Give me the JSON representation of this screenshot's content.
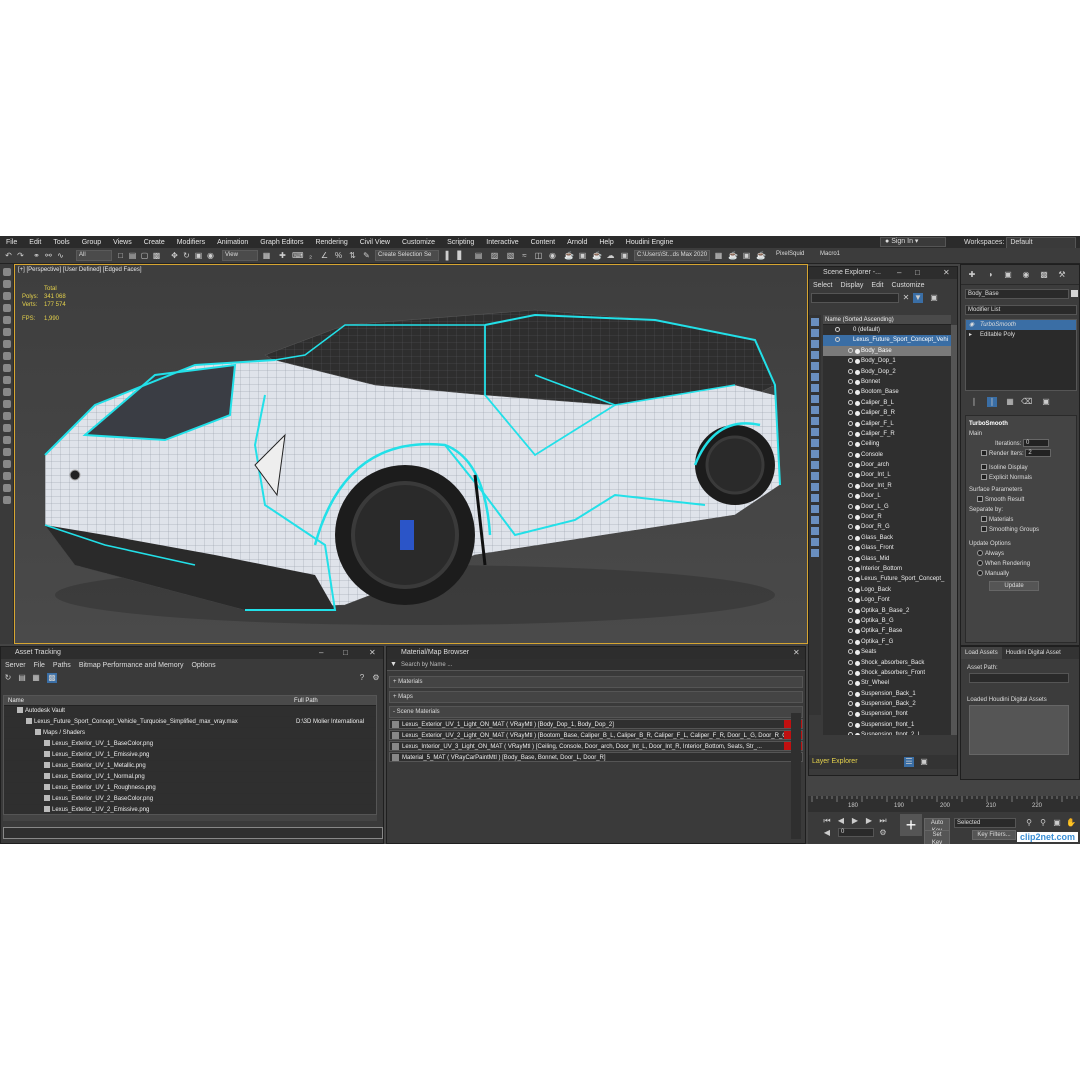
{
  "menu": [
    "File",
    "Edit",
    "Tools",
    "Group",
    "Views",
    "Create",
    "Modifiers",
    "Animation",
    "Graph Editors",
    "Rendering",
    "Civil View",
    "Customize",
    "Scripting",
    "Interactive",
    "Content",
    "Arnold",
    "Help",
    "Houdini Engine"
  ],
  "signin": "Sign In",
  "workspaces": {
    "label": "Workspaces:",
    "value": "Default"
  },
  "toolbar": {
    "filter": "All",
    "view": "View",
    "selection_set": "Create Selection Se",
    "path": "C:\\Users\\St...ds Max 2020",
    "pixelsquid": "PixelSquid",
    "macro": "Macro1"
  },
  "viewport": {
    "label": "[+] [Perspective] [User Defined] [Edged Faces]",
    "stats": {
      "total": "Total",
      "polys_label": "Polys:",
      "polys": "341 068",
      "verts_label": "Verts:",
      "verts": "177 574",
      "fps_label": "FPS:",
      "fps": "1,990"
    }
  },
  "scene_explorer": {
    "title": "Scene Explorer -...",
    "menu": [
      "Select",
      "Display",
      "Edit",
      "Customize"
    ],
    "column": "Name (Sorted Ascending)",
    "layer": "0 (default)",
    "root": "Lexus_Future_Sport_Concept_Vehi",
    "items": [
      "Body_Base",
      "Body_Dop_1",
      "Body_Dop_2",
      "Bonnet",
      "Bootom_Base",
      "Caliper_B_L",
      "Caliper_B_R",
      "Caliper_F_L",
      "Caliper_F_R",
      "Ceiling",
      "Console",
      "Door_arch",
      "Door_Int_L",
      "Door_Int_R",
      "Door_L",
      "Door_L_G",
      "Door_R",
      "Door_R_G",
      "Glass_Back",
      "Glass_Front",
      "Glass_Mid",
      "Interior_Bottom",
      "Lexus_Future_Sport_Concept_",
      "Logo_Back",
      "Logo_Font",
      "Optika_B_Base_2",
      "Optika_B_G",
      "Optika_F_Base",
      "Optika_F_G",
      "Seats",
      "Shock_absorbers_Back",
      "Shock_absorbers_Front",
      "Str_Wheel",
      "Suspension_Back_1",
      "Suspension_Back_2",
      "Suspension_front",
      "Suspension_front_1",
      "Suspension_front_2_L"
    ],
    "footer": "Layer Explorer"
  },
  "modifier_panel": {
    "object_name": "Body_Base",
    "modifier_list": "Modifier List",
    "stack": [
      "TurboSmooth",
      "Editable Poly"
    ],
    "rollout": "TurboSmooth",
    "main": "Main",
    "iterations_label": "Iterations:",
    "iterations": "0",
    "render_iters_label": "Render Iters:",
    "render_iters": "2",
    "isoline": "Isoline Display",
    "explicit": "Explicit Normals",
    "surface_params": "Surface Parameters",
    "smooth_result": "Smooth Result",
    "separate_by": "Separate by:",
    "materials": "Materials",
    "smoothing_groups": "Smoothing Groups",
    "update_options": "Update Options",
    "always": "Always",
    "when_rendering": "When Rendering",
    "manually": "Manually",
    "update_btn": "Update"
  },
  "assets_panel": {
    "tabs": [
      "Load Assets",
      "Houdini Digital Asset"
    ],
    "asset_path": "Asset Path:",
    "loaded": "Loaded Houdini Digital Assets"
  },
  "asset_tracking": {
    "title": "Asset Tracking",
    "menu": [
      "Server",
      "File",
      "Paths",
      "Bitmap Performance and Memory",
      "Options"
    ],
    "columns": [
      "Name",
      "Full Path"
    ],
    "rows": [
      {
        "name": "Autodesk Vault",
        "path": "",
        "indent": 1
      },
      {
        "name": "Lexus_Future_Sport_Concept_Vehicle_Turquoise_Simplified_max_vray.max",
        "path": "D:\\3D Molier International",
        "indent": 2
      },
      {
        "name": "Maps / Shaders",
        "path": "",
        "indent": 3
      },
      {
        "name": "Lexus_Exterior_UV_1_BaseColor.png",
        "path": "",
        "indent": 4
      },
      {
        "name": "Lexus_Exterior_UV_1_Emissive.png",
        "path": "",
        "indent": 4
      },
      {
        "name": "Lexus_Exterior_UV_1_Metallic.png",
        "path": "",
        "indent": 4
      },
      {
        "name": "Lexus_Exterior_UV_1_Normal.png",
        "path": "",
        "indent": 4
      },
      {
        "name": "Lexus_Exterior_UV_1_Roughness.png",
        "path": "",
        "indent": 4
      },
      {
        "name": "Lexus_Exterior_UV_2_BaseColor.png",
        "path": "",
        "indent": 4
      },
      {
        "name": "Lexus_Exterior_UV_2_Emissive.png",
        "path": "",
        "indent": 4
      }
    ]
  },
  "material_browser": {
    "title": "Material/Map Browser",
    "search": "Search by Name ...",
    "sections": [
      "+ Materials",
      "+ Maps",
      "- Scene Materials"
    ],
    "materials": [
      "Lexus_Exterior_UV_1_Light_ON_MAT ( VRayMtl ) [Body_Dop_1, Body_Dop_2]",
      "Lexus_Exterior_UV_2_Light_ON_MAT ( VRayMtl ) [Bootom_Base, Caliper_B_L, Caliper_B_R, Caliper_F_L, Caliper_F_R, Door_L_G, Door_R_G, ...",
      "Lexus_Interior_UV_3_Light_ON_MAT ( VRayMtl ) [Ceiling, Console, Door_arch, Door_Int_L, Door_Int_R, Interior_Bottom, Seats, Str_...",
      "Material_5_MAT ( VRayCarPaintMtl ) [Body_Base, Bonnet, Door_L, Door_R]"
    ]
  },
  "timeline": {
    "ticks": [
      "180",
      "190",
      "200",
      "210",
      "220"
    ],
    "frame": "0",
    "auto_key": "Auto Key",
    "set_key": "Set Key",
    "selected": "Selected",
    "key_filters": "Key Filters..."
  },
  "watermark": "clip2net.com",
  "colors": {
    "wire": "#22e0e8",
    "mesh": "#dfe3ea",
    "accent": "#d6a531",
    "selection": "#3a6ea5"
  }
}
